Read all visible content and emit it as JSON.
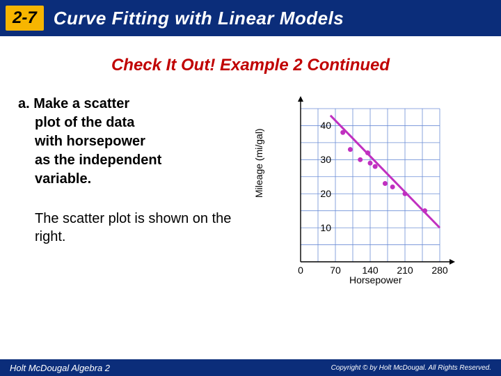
{
  "header": {
    "section": "2-7",
    "title": "Curve Fitting with Linear Models"
  },
  "subheader": "Check It Out! Example 2 Continued",
  "prompt": {
    "label": "a.",
    "line1": "Make a scatter",
    "line2": "plot of the data",
    "line3": "with horsepower",
    "line4": "as the independent",
    "line5": "variable."
  },
  "answer": "The scatter plot is shown on the right.",
  "chart_data": {
    "type": "scatter",
    "xlabel": "Horsepower",
    "ylabel": "Mileage (mi/gal)",
    "xlim": [
      0,
      280
    ],
    "ylim": [
      0,
      45
    ],
    "xticks": [
      0,
      70,
      140,
      210,
      280
    ],
    "yticks": [
      10,
      20,
      30,
      40
    ],
    "points": [
      {
        "x": 85,
        "y": 38
      },
      {
        "x": 100,
        "y": 33
      },
      {
        "x": 120,
        "y": 30
      },
      {
        "x": 135,
        "y": 32
      },
      {
        "x": 140,
        "y": 29
      },
      {
        "x": 150,
        "y": 28
      },
      {
        "x": 170,
        "y": 23
      },
      {
        "x": 185,
        "y": 22
      },
      {
        "x": 210,
        "y": 20
      },
      {
        "x": 250,
        "y": 15
      }
    ],
    "trendline": {
      "x1": 60,
      "y1": 43,
      "x2": 280,
      "y2": 10
    }
  },
  "footer": {
    "left": "Holt McDougal Algebra 2",
    "right": "Copyright © by Holt McDougal. All Rights Reserved."
  }
}
